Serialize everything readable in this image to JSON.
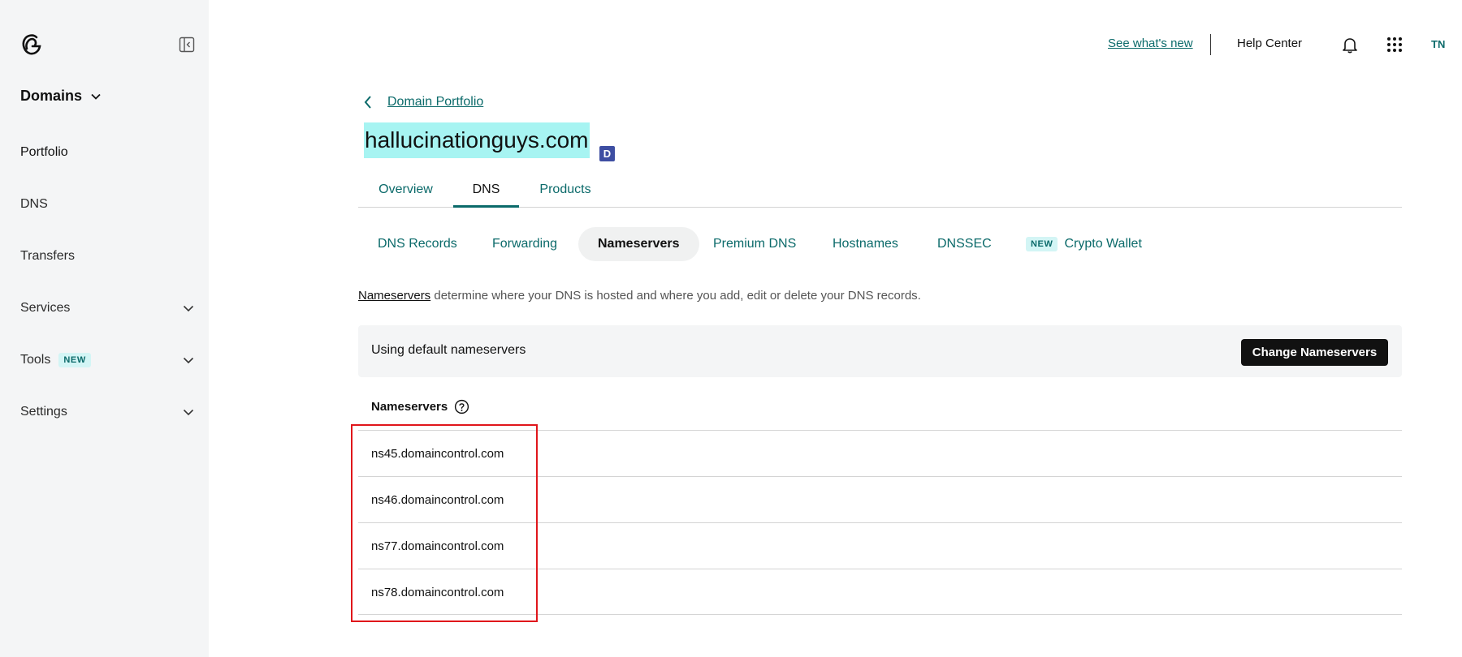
{
  "sidebar": {
    "heading": "Domains",
    "items": [
      {
        "label": "Portfolio"
      },
      {
        "label": "DNS"
      },
      {
        "label": "Transfers"
      },
      {
        "label": "Services"
      },
      {
        "label": "Tools",
        "badge": "NEW"
      },
      {
        "label": "Settings"
      }
    ]
  },
  "topbar": {
    "whats_new": "See what's new",
    "help": "Help Center",
    "avatar": "TN"
  },
  "breadcrumb": {
    "label": "Domain Portfolio"
  },
  "domain": {
    "name": "hallucinationguys.com",
    "badge": "D"
  },
  "tabs": [
    {
      "label": "Overview"
    },
    {
      "label": "DNS",
      "active": true
    },
    {
      "label": "Products"
    }
  ],
  "subtabs": [
    {
      "label": "DNS Records"
    },
    {
      "label": "Forwarding"
    },
    {
      "label": "Nameservers",
      "active": true
    },
    {
      "label": "Premium DNS"
    },
    {
      "label": "Hostnames"
    },
    {
      "label": "DNSSEC"
    },
    {
      "label": "Crypto Wallet",
      "badge": "NEW"
    }
  ],
  "intro": {
    "link": "Nameservers",
    "text": " determine where your DNS is hosted and where you add, edit or delete your DNS records."
  },
  "panel": {
    "status": "Using default nameservers",
    "button": "Change Nameservers"
  },
  "nameservers": {
    "header": "Nameservers",
    "list": [
      "ns45.domaincontrol.com",
      "ns46.domaincontrol.com",
      "ns77.domaincontrol.com",
      "ns78.domaincontrol.com"
    ]
  },
  "colors": {
    "accent": "#0b6a6a",
    "highlight": "#a7f4f2",
    "annotation": "#e0161b"
  }
}
